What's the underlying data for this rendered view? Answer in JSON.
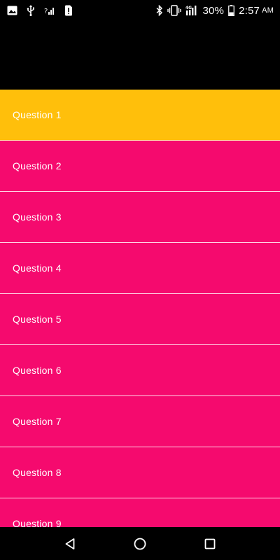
{
  "status_bar": {
    "battery_percent": "30%",
    "time": "2:57",
    "ampm": "AM",
    "network_label": "4G",
    "icons": [
      "image-icon",
      "usb-icon",
      "signal-question-icon",
      "sim-alert-icon",
      "bluetooth-icon",
      "vibrate-icon",
      "lte-signal-icon",
      "battery-icon"
    ]
  },
  "list": {
    "selected_index": 0,
    "items": [
      {
        "label": "Question 1"
      },
      {
        "label": "Question 2"
      },
      {
        "label": "Question 3"
      },
      {
        "label": "Question 4"
      },
      {
        "label": "Question 5"
      },
      {
        "label": "Question 6"
      },
      {
        "label": "Question 7"
      },
      {
        "label": "Question 8"
      },
      {
        "label": "Question 9"
      }
    ]
  },
  "colors": {
    "selected_item": "#ffbf0b",
    "item": "#f50a6e",
    "background": "#000000",
    "text": "#ffffff"
  },
  "nav_bar": {
    "icons": [
      "back-icon",
      "home-icon",
      "recents-icon"
    ]
  }
}
